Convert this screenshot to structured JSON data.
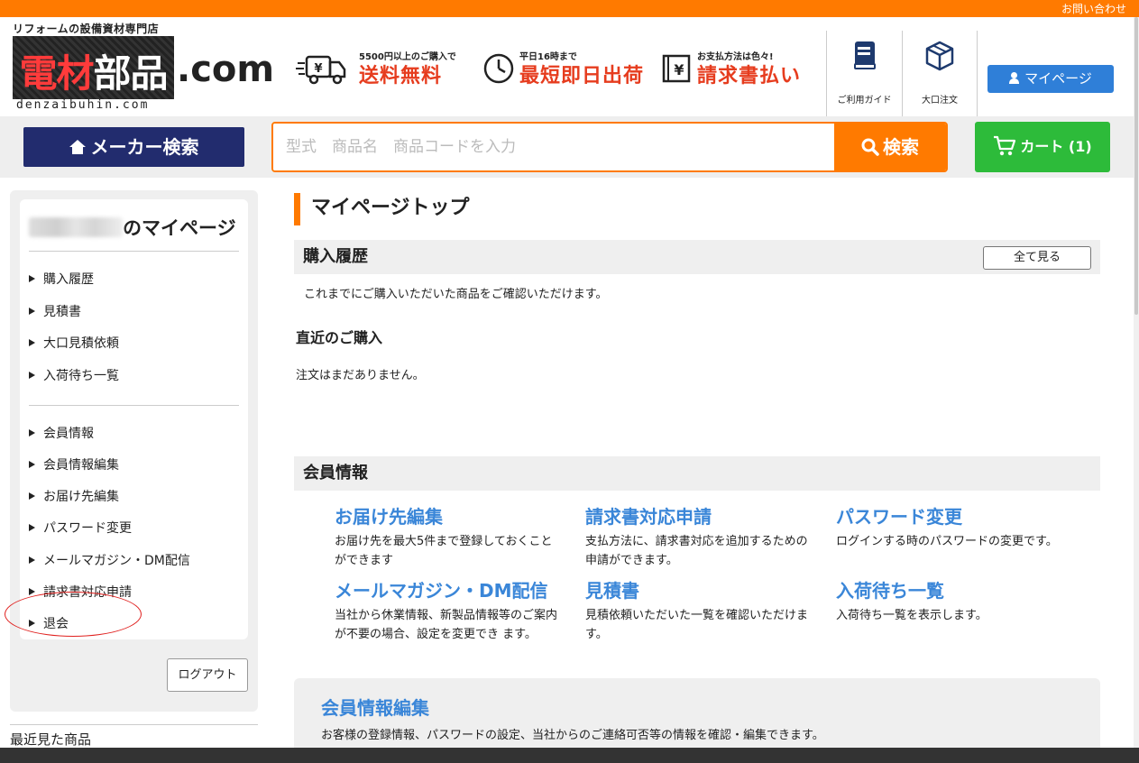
{
  "topbar": {
    "contact": "お問い合わせ"
  },
  "logo": {
    "tagline": "リフォームの設備資材専門店",
    "main_red": "電材",
    "main_white": "部品",
    "com": ".com",
    "sub": "denzaibuhin.com"
  },
  "features": [
    {
      "small": "5500円以上のご購入で",
      "big": "送料無料",
      "icon": "truck-yen-icon"
    },
    {
      "small": "平日16時まで",
      "big": "最短即日出荷",
      "icon": "clock-icon"
    },
    {
      "small": "お支払方法は色々!",
      "big": "請求書払い",
      "icon": "invoice-yen-icon"
    }
  ],
  "header_links": {
    "guide": "ご利用ガイド",
    "bulk": "大口注文",
    "mypage": "マイページ"
  },
  "search": {
    "maker_label": "メーカー検索",
    "placeholder": "型式　商品名　商品コードを入力",
    "value": "",
    "button": "検索",
    "cart": "カート (1)"
  },
  "sidebar": {
    "title_suffix": "のマイページ",
    "group1": [
      "購入履歴",
      "見積書",
      "大口見積依頼",
      "入荷待ち一覧"
    ],
    "group2": [
      "会員情報",
      "会員情報編集",
      "お届け先編集",
      "パスワード変更",
      "メールマガジン・DM配信",
      "請求書対応申請",
      "退会"
    ],
    "logout": "ログアウト",
    "recent": "最近見た商品"
  },
  "main": {
    "title": "マイページトップ",
    "purchase_head": "購入履歴",
    "see_all": "全て見る",
    "purchase_desc": "これまでにご購入いただいた商品をご確認いただけます。",
    "recent_head": "直近のご購入",
    "no_orders": "注文はまだありません。",
    "member_head": "会員情報",
    "cards": [
      {
        "title": "お届け先編集",
        "desc": "お届け先を最大5件まで登録しておくことができます"
      },
      {
        "title": "請求書対応申請",
        "desc": "支払方法に、請求書対応を追加するための申請ができます。"
      },
      {
        "title": "パスワード変更",
        "desc": "ログインする時のパスワードの変更です。"
      },
      {
        "title": "メールマガジン・DM配信",
        "desc": "当社から休業情報、新製品情報等のご案内が不要の場合、設定を変更でき ます。"
      },
      {
        "title": "見積書",
        "desc": "見積依頼いただいた一覧を確認いただけます。"
      },
      {
        "title": "入荷待ち一覧",
        "desc": "入荷待ち一覧を表示します。"
      }
    ],
    "edit_title": "会員情報編集",
    "edit_desc": "お客様の登録情報、パスワードの設定、当社からのご連絡可否等の情報を確認・編集できます。"
  },
  "colors": {
    "orange": "#ff7a00",
    "navy": "#222c6e",
    "green": "#2dbb3a",
    "blue": "#2f7fd8",
    "link_blue": "#3a86d8",
    "annotation_red": "#e0211f"
  }
}
